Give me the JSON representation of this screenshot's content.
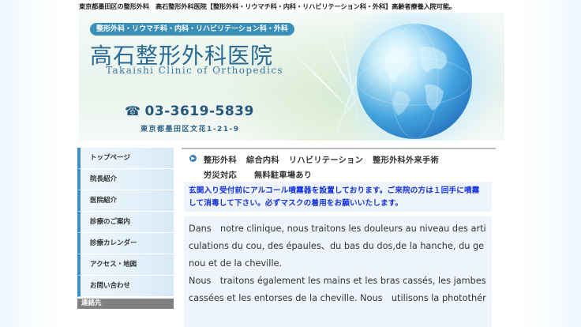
{
  "top_strip": "東京都墨田区の整形外科　高石整形外科医院【整形外科・リウマチ科・内科・リハビリテーション科・外科】高齢者療養入院可能。",
  "header": {
    "badge": "整形外科・リウマチ科・内科・リハビリテーション科・外科",
    "clinic_name": "高石整形外科医院",
    "clinic_name_en": "Takaishi Clinic of Orthopedics",
    "phone": "03-3619-5839",
    "address": "東京都墨田区文花1-21-9"
  },
  "sidebar": {
    "items": [
      {
        "label": "トップページ"
      },
      {
        "label": "院長紹介"
      },
      {
        "label": "医院紹介"
      },
      {
        "label": "診療のご案内"
      },
      {
        "label": "診療カレンダー"
      },
      {
        "label": "アクセス・地図"
      },
      {
        "label": "お問い合わせ"
      }
    ],
    "contact_heading": "連絡先"
  },
  "services": {
    "line1": [
      "整形外科",
      "綜合内科",
      "リハビリテーション",
      "整形外科外来手術"
    ],
    "line2": [
      "労災対応",
      "無料駐車場あり"
    ]
  },
  "notice": "玄関入り受付前にアルコール噴霧器を設置しております。ご来院の方は１回手に噴霧して消毒して下さい。必ずマスクの着用をお願いいたします。",
  "french": {
    "p1": "Dans　notre clinique, nous traitons les douleurs au niveau des articulations du cou, des épaules、du bas du dos,de la hanche, du genou et de la cheville.",
    "p2": "Nous　traitons également les mains et les bras cassés, les jambes cassées et les entorses de la cheville. Nous　utilisons la photothér"
  }
}
